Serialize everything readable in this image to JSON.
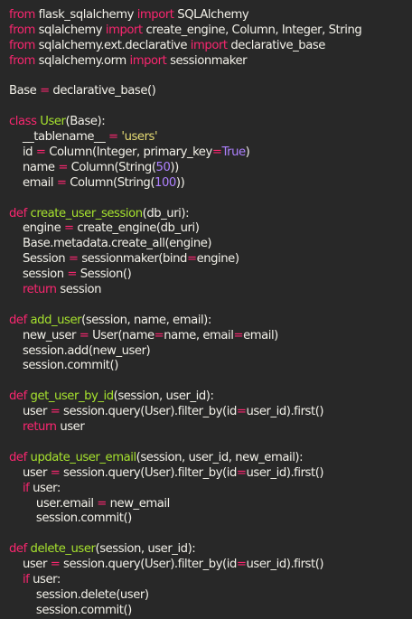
{
  "theme": {
    "background": "#282828",
    "plain": "#f2f0e8",
    "keyword": "#f9266f",
    "function": "#a6e22e",
    "string": "#e6db74",
    "number": "#ae81ff"
  },
  "code_lines": [
    [
      [
        "kw",
        "from"
      ],
      [
        "pl",
        " flask_sqlalchemy "
      ],
      [
        "kw",
        "import"
      ],
      [
        "pl",
        " SQLAlchemy"
      ]
    ],
    [
      [
        "kw",
        "from"
      ],
      [
        "pl",
        " sqlalchemy "
      ],
      [
        "kw",
        "import"
      ],
      [
        "pl",
        " create_engine, Column, Integer, String"
      ]
    ],
    [
      [
        "kw",
        "from"
      ],
      [
        "pl",
        " sqlalchemy.ext.declarative "
      ],
      [
        "kw",
        "import"
      ],
      [
        "pl",
        " declarative_base"
      ]
    ],
    [
      [
        "kw",
        "from"
      ],
      [
        "pl",
        " sqlalchemy.orm "
      ],
      [
        "kw",
        "import"
      ],
      [
        "pl",
        " sessionmaker"
      ]
    ],
    [],
    [
      [
        "pl",
        "Base "
      ],
      [
        "kw",
        "="
      ],
      [
        "pl",
        " declarative_base()"
      ]
    ],
    [],
    [
      [
        "kw",
        "class"
      ],
      [
        "pl",
        " "
      ],
      [
        "fn",
        "User"
      ],
      [
        "pl",
        "(Base):"
      ]
    ],
    [
      [
        "pl",
        "    __tablename__ "
      ],
      [
        "kw",
        "="
      ],
      [
        "pl",
        " "
      ],
      [
        "str",
        "'users'"
      ]
    ],
    [
      [
        "pl",
        "    id "
      ],
      [
        "kw",
        "="
      ],
      [
        "pl",
        " Column(Integer, primary_key"
      ],
      [
        "kw",
        "="
      ],
      [
        "num",
        "True"
      ],
      [
        "pl",
        ")"
      ]
    ],
    [
      [
        "pl",
        "    name "
      ],
      [
        "kw",
        "="
      ],
      [
        "pl",
        " Column(String("
      ],
      [
        "num",
        "50"
      ],
      [
        "pl",
        "))"
      ]
    ],
    [
      [
        "pl",
        "    email "
      ],
      [
        "kw",
        "="
      ],
      [
        "pl",
        " Column(String("
      ],
      [
        "num",
        "100"
      ],
      [
        "pl",
        "))"
      ]
    ],
    [],
    [
      [
        "kw",
        "def"
      ],
      [
        "pl",
        " "
      ],
      [
        "fn",
        "create_user_session"
      ],
      [
        "pl",
        "(db_uri):"
      ]
    ],
    [
      [
        "pl",
        "    engine "
      ],
      [
        "kw",
        "="
      ],
      [
        "pl",
        " create_engine(db_uri)"
      ]
    ],
    [
      [
        "pl",
        "    Base.metadata.create_all(engine)"
      ]
    ],
    [
      [
        "pl",
        "    Session "
      ],
      [
        "kw",
        "="
      ],
      [
        "pl",
        " sessionmaker(bind"
      ],
      [
        "kw",
        "="
      ],
      [
        "pl",
        "engine)"
      ]
    ],
    [
      [
        "pl",
        "    session "
      ],
      [
        "kw",
        "="
      ],
      [
        "pl",
        " Session()"
      ]
    ],
    [
      [
        "pl",
        "    "
      ],
      [
        "kw",
        "return"
      ],
      [
        "pl",
        " session"
      ]
    ],
    [],
    [
      [
        "kw",
        "def"
      ],
      [
        "pl",
        " "
      ],
      [
        "fn",
        "add_user"
      ],
      [
        "pl",
        "(session, name, email):"
      ]
    ],
    [
      [
        "pl",
        "    new_user "
      ],
      [
        "kw",
        "="
      ],
      [
        "pl",
        " User(name"
      ],
      [
        "kw",
        "="
      ],
      [
        "pl",
        "name, email"
      ],
      [
        "kw",
        "="
      ],
      [
        "pl",
        "email)"
      ]
    ],
    [
      [
        "pl",
        "    session.add(new_user)"
      ]
    ],
    [
      [
        "pl",
        "    session.commit()"
      ]
    ],
    [],
    [
      [
        "kw",
        "def"
      ],
      [
        "pl",
        " "
      ],
      [
        "fn",
        "get_user_by_id"
      ],
      [
        "pl",
        "(session, user_id):"
      ]
    ],
    [
      [
        "pl",
        "    user "
      ],
      [
        "kw",
        "="
      ],
      [
        "pl",
        " session.query(User).filter_by(id"
      ],
      [
        "kw",
        "="
      ],
      [
        "pl",
        "user_id).first()"
      ]
    ],
    [
      [
        "pl",
        "    "
      ],
      [
        "kw",
        "return"
      ],
      [
        "pl",
        " user"
      ]
    ],
    [],
    [
      [
        "kw",
        "def"
      ],
      [
        "pl",
        " "
      ],
      [
        "fn",
        "update_user_email"
      ],
      [
        "pl",
        "(session, user_id, new_email):"
      ]
    ],
    [
      [
        "pl",
        "    user "
      ],
      [
        "kw",
        "="
      ],
      [
        "pl",
        " session.query(User).filter_by(id"
      ],
      [
        "kw",
        "="
      ],
      [
        "pl",
        "user_id).first()"
      ]
    ],
    [
      [
        "pl",
        "    "
      ],
      [
        "kw",
        "if"
      ],
      [
        "pl",
        " user:"
      ]
    ],
    [
      [
        "pl",
        "        user.email "
      ],
      [
        "kw",
        "="
      ],
      [
        "pl",
        " new_email"
      ]
    ],
    [
      [
        "pl",
        "        session.commit()"
      ]
    ],
    [],
    [
      [
        "kw",
        "def"
      ],
      [
        "pl",
        " "
      ],
      [
        "fn",
        "delete_user"
      ],
      [
        "pl",
        "(session, user_id):"
      ]
    ],
    [
      [
        "pl",
        "    user "
      ],
      [
        "kw",
        "="
      ],
      [
        "pl",
        " session.query(User).filter_by(id"
      ],
      [
        "kw",
        "="
      ],
      [
        "pl",
        "user_id).first()"
      ]
    ],
    [
      [
        "pl",
        "    "
      ],
      [
        "kw",
        "if"
      ],
      [
        "pl",
        " user:"
      ]
    ],
    [
      [
        "pl",
        "        session.delete(user)"
      ]
    ],
    [
      [
        "pl",
        "        session.commit()"
      ]
    ]
  ]
}
